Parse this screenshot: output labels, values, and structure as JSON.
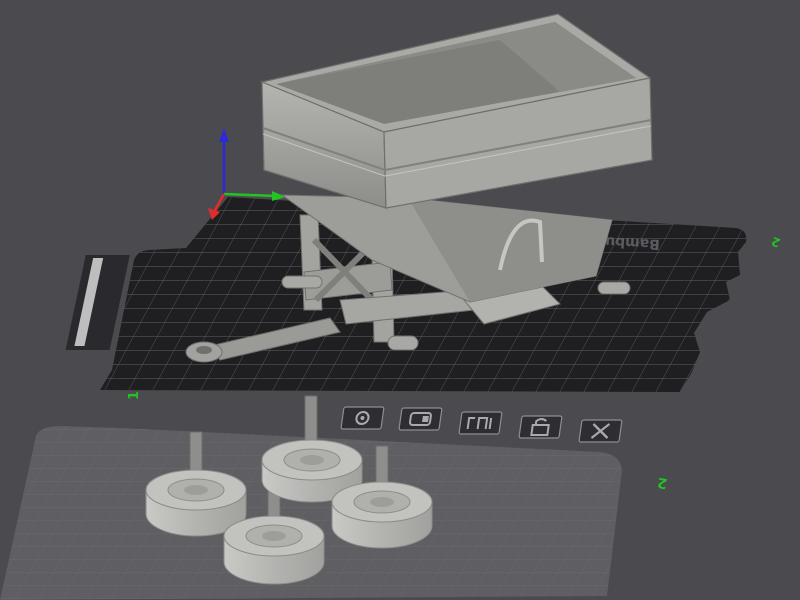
{
  "viewport": {
    "background_color": "#4a4a4f"
  },
  "plates": [
    {
      "name": "plate-1",
      "index_label": "1",
      "brand_label": "Bambu Tex",
      "color": "#1f1f22",
      "grid_color": "#8a8a90",
      "active": true
    },
    {
      "name": "plate-2",
      "index_label": "2",
      "color": "#5e5e63",
      "grid_color": "#6f6f74",
      "active": false
    }
  ],
  "plate_toolbar": {
    "icons": [
      "orient-icon",
      "arrange-icon",
      "plate-settings-icon",
      "lock-icon",
      "delete-plate-icon"
    ]
  },
  "axes": {
    "x_color": "#22c322",
    "y_color": "#e22b2b",
    "z_color": "#2b2bd8"
  },
  "objects": {
    "hopper_color": "#a6a7a3",
    "wheel_color": "#bcbcb9",
    "axle_color": "#8e8f8d",
    "wheel_count": 4
  }
}
